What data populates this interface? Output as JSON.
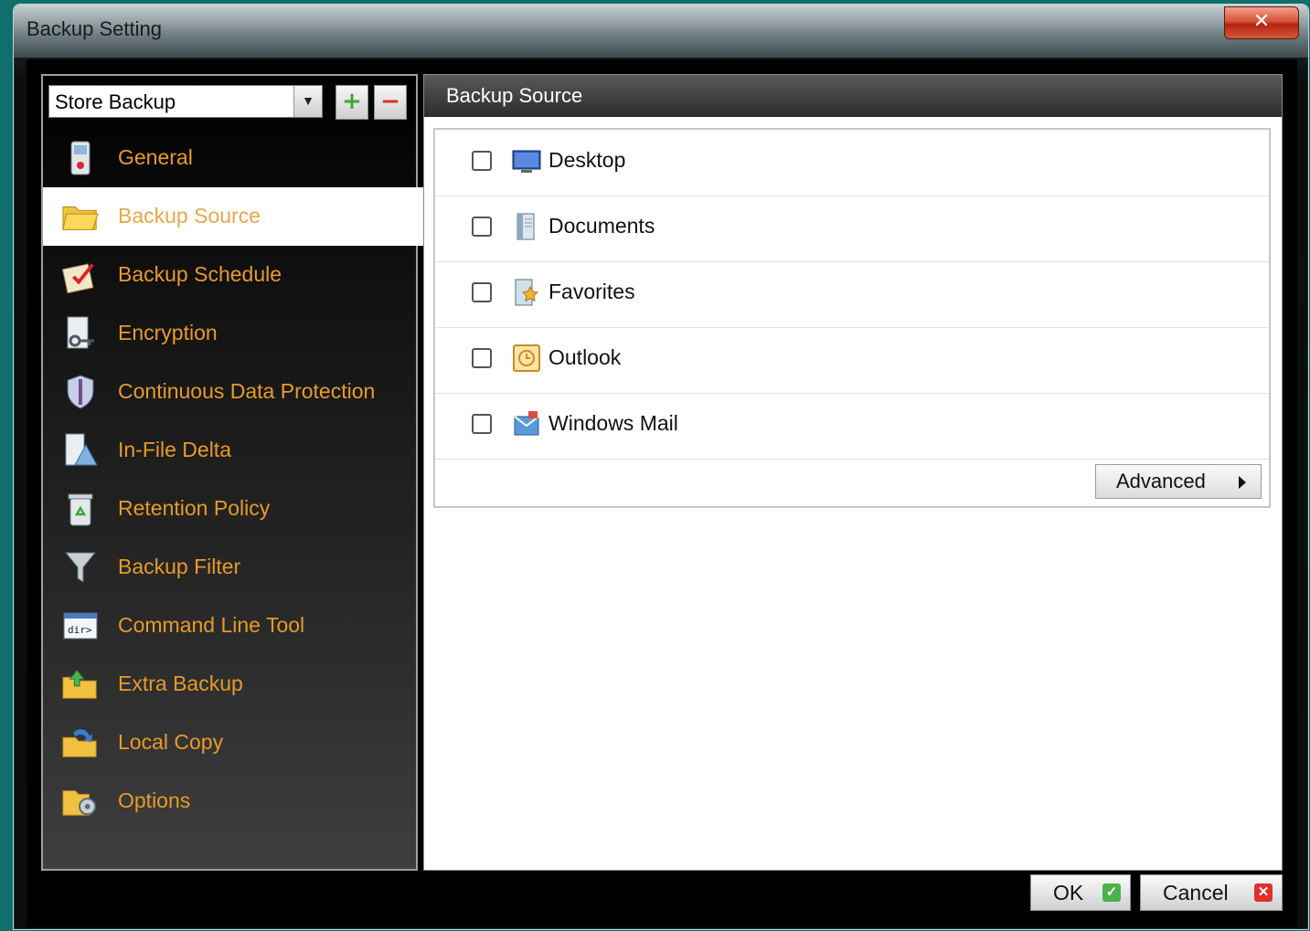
{
  "window": {
    "title": "Backup Setting",
    "close_label": "✕"
  },
  "profile": {
    "selected": "Store Backup",
    "add_label": "+",
    "remove_label": "−"
  },
  "nav": {
    "active_index": 1,
    "items": [
      {
        "label": "General",
        "icon": "general-icon"
      },
      {
        "label": "Backup Source",
        "icon": "folder-icon"
      },
      {
        "label": "Backup Schedule",
        "icon": "schedule-icon"
      },
      {
        "label": "Encryption",
        "icon": "encryption-key-icon"
      },
      {
        "label": "Continuous Data Protection",
        "icon": "shield-icon"
      },
      {
        "label": "In-File Delta",
        "icon": "delta-icon"
      },
      {
        "label": "Retention Policy",
        "icon": "recycle-bin-icon"
      },
      {
        "label": "Backup Filter",
        "icon": "funnel-icon"
      },
      {
        "label": "Command Line Tool",
        "icon": "command-line-icon"
      },
      {
        "label": "Extra Backup",
        "icon": "extra-backup-icon"
      },
      {
        "label": "Local Copy",
        "icon": "local-copy-icon"
      },
      {
        "label": "Options",
        "icon": "options-gear-icon"
      }
    ]
  },
  "main": {
    "section_title": "Backup Source",
    "sources": [
      {
        "label": "Desktop",
        "icon": "desktop-icon",
        "checked": false
      },
      {
        "label": "Documents",
        "icon": "documents-icon",
        "checked": false
      },
      {
        "label": "Favorites",
        "icon": "favorites-icon",
        "checked": false
      },
      {
        "label": "Outlook",
        "icon": "outlook-icon",
        "checked": false
      },
      {
        "label": "Windows Mail",
        "icon": "windows-mail-icon",
        "checked": false
      }
    ],
    "advanced_label": "Advanced"
  },
  "footer": {
    "ok_label": "OK",
    "cancel_label": "Cancel"
  },
  "colors": {
    "nav_text": "#e79a2a",
    "background": "#0f6f6b"
  }
}
